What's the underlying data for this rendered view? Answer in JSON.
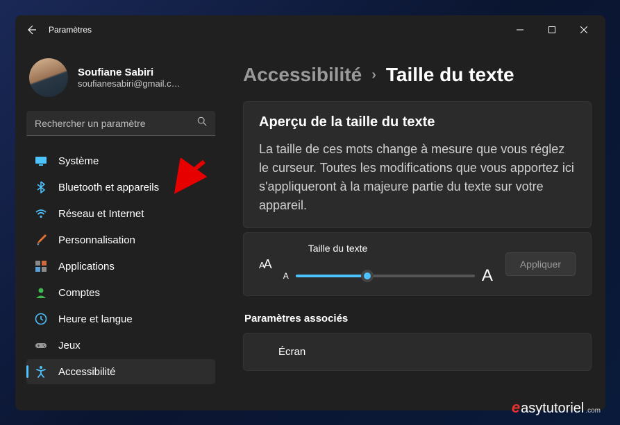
{
  "window": {
    "title": "Paramètres"
  },
  "profile": {
    "name": "Soufiane Sabiri",
    "email": "soufianesabiri@gmail.c…"
  },
  "search": {
    "placeholder": "Rechercher un paramètre"
  },
  "nav": [
    {
      "id": "system",
      "label": "Système",
      "icon": "monitor",
      "color": "#4cc2ff"
    },
    {
      "id": "bluetooth",
      "label": "Bluetooth et appareils",
      "icon": "bluetooth",
      "color": "#4cc2ff"
    },
    {
      "id": "network",
      "label": "Réseau et Internet",
      "icon": "wifi",
      "color": "#4cc2ff"
    },
    {
      "id": "personalization",
      "label": "Personnalisation",
      "icon": "brush",
      "color": "#e67330"
    },
    {
      "id": "apps",
      "label": "Applications",
      "icon": "apps",
      "color": "#8a8a8a"
    },
    {
      "id": "accounts",
      "label": "Comptes",
      "icon": "person",
      "color": "#3fb950"
    },
    {
      "id": "time",
      "label": "Heure et langue",
      "icon": "clock",
      "color": "#4cc2ff"
    },
    {
      "id": "gaming",
      "label": "Jeux",
      "icon": "gamepad",
      "color": "#9a9a9a"
    },
    {
      "id": "accessibility",
      "label": "Accessibilité",
      "icon": "accessibility",
      "color": "#4cc2ff",
      "active": true
    }
  ],
  "breadcrumb": {
    "parent": "Accessibilité",
    "current": "Taille du texte"
  },
  "preview": {
    "heading": "Aperçu de la taille du texte",
    "text": "La taille de ces mots change à mesure que vous réglez le curseur. Toutes les modifications que vous apportez ici s'appliqueront à la majeure partie du texte sur votre appareil."
  },
  "slider": {
    "label": "Taille du texte",
    "small": "A",
    "large": "A",
    "apply": "Appliquer",
    "value_percent": 40
  },
  "related": {
    "heading": "Paramètres associés",
    "items": [
      "Écran"
    ]
  },
  "watermark": {
    "prefix": "e",
    "text": "asytutoriel",
    "suffix": ".com"
  }
}
